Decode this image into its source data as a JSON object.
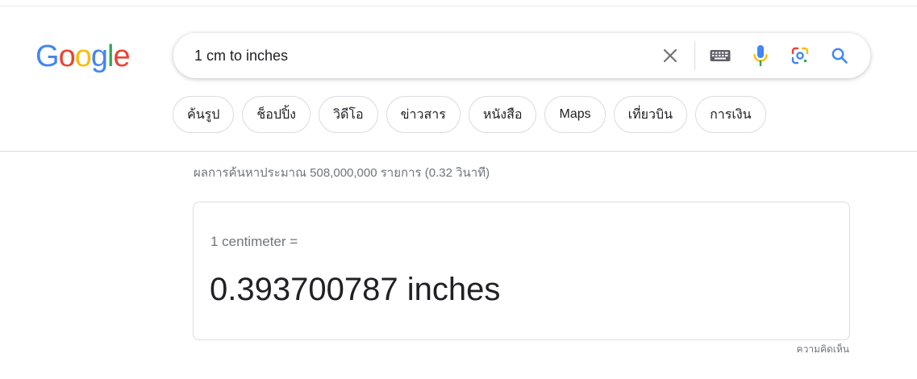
{
  "logo": {
    "text": "Google"
  },
  "search": {
    "query": "1 cm to inches",
    "icons": [
      "close-icon",
      "keyboard-icon",
      "mic-icon",
      "lens-icon",
      "search-icon"
    ]
  },
  "chips": [
    {
      "label": "ค้นรูป"
    },
    {
      "label": "ช็อปปิ้ง"
    },
    {
      "label": "วิดีโอ"
    },
    {
      "label": "ข่าวสาร"
    },
    {
      "label": "หนังสือ"
    },
    {
      "label": "Maps"
    },
    {
      "label": "เที่ยวบิน"
    },
    {
      "label": "การเงิน"
    }
  ],
  "results": {
    "stats": "ผลการค้นหาประมาณ 508,000,000 รายการ (0.32 วินาที)"
  },
  "conversion": {
    "from_text": "1 centimeter =",
    "result_text": "0.393700787 inches"
  },
  "feedback": {
    "label": "ความคิดเห็น"
  },
  "colors": {
    "google_blue": "#4285f4",
    "google_red": "#ea4335",
    "google_yellow": "#fbbc05",
    "google_green": "#34a853",
    "text_primary": "#202124",
    "text_secondary": "#70757a",
    "border": "#dadce0"
  }
}
